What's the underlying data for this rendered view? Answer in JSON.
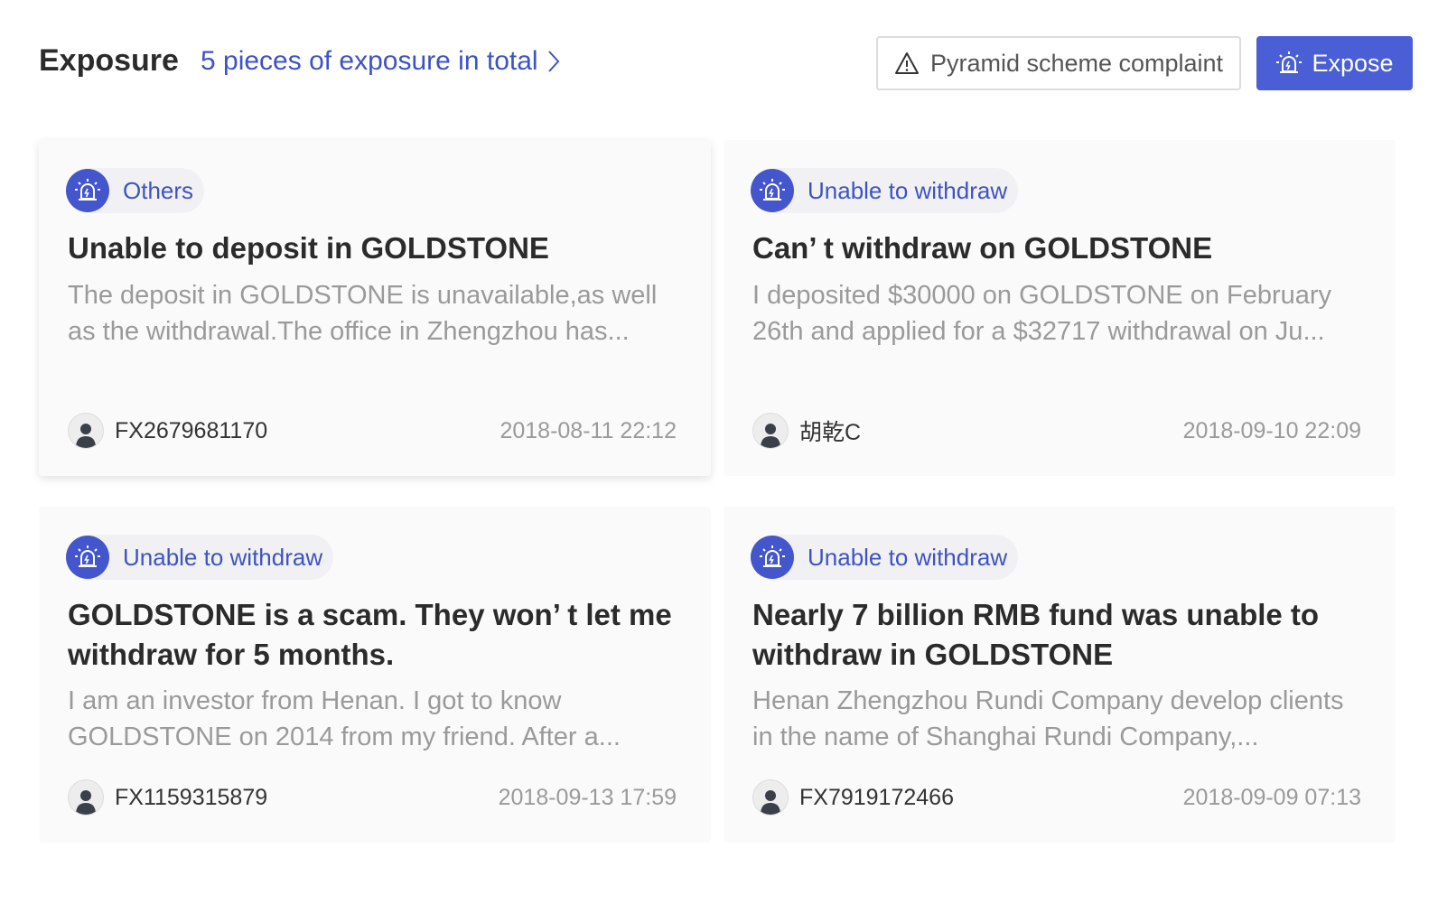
{
  "header": {
    "title": "Exposure",
    "total_link": "5 pieces of exposure in total",
    "complaint_button": "Pyramid scheme complaint",
    "expose_button": "Expose"
  },
  "colors": {
    "accent": "#4a5ed6",
    "link": "#3d53c4",
    "tag_bg": "#f1f1f3"
  },
  "cards": [
    {
      "tag": "Others",
      "title": "Unable to deposit in GOLDSTONE",
      "desc": "The deposit in GOLDSTONE is unavailable,as well as the withdrawal.The office in Zhengzhou has...",
      "author": "FX2679681170",
      "date": "2018-08-11 22:12"
    },
    {
      "tag": "Unable to withdraw",
      "title": "Can’ t withdraw on GOLDSTONE",
      "desc": "I deposited $30000 on GOLDSTONE on February 26th and applied for a $32717 withdrawal on Ju...",
      "author": "胡乾C",
      "date": "2018-09-10 22:09"
    },
    {
      "tag": "Unable to withdraw",
      "title": "GOLDSTONE is a scam. They won’ t let me withdraw for 5 months.",
      "desc": "I am an investor from Henan. I got to know GOLDSTONE on 2014 from my friend. After a...",
      "author": "FX1159315879",
      "date": "2018-09-13 17:59"
    },
    {
      "tag": "Unable to withdraw",
      "title": "Nearly 7 billion RMB fund was unable to withdraw in GOLDSTONE",
      "desc": "Henan Zhengzhou Rundi Company develop clients in the name of Shanghai Rundi Company,...",
      "author": "FX7919172466",
      "date": "2018-09-09 07:13"
    }
  ]
}
